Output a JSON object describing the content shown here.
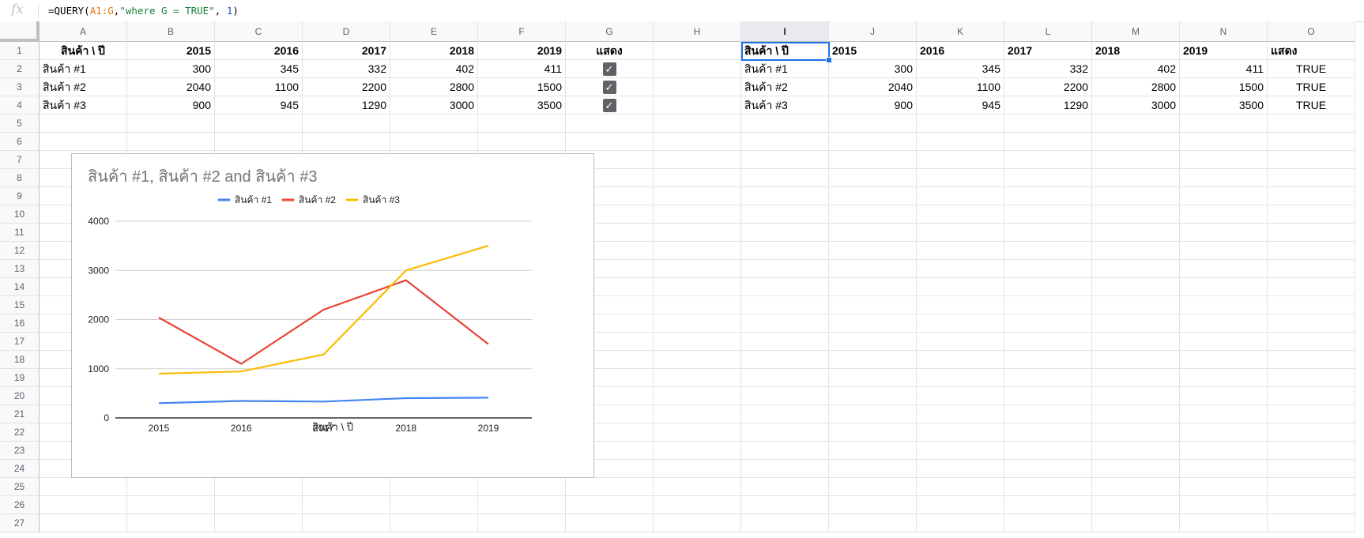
{
  "formula_bar": {
    "fx_label": "fx",
    "prefix": "=QUERY(",
    "range": "A1:G",
    "sep1": ",",
    "query_string": "\"where G = TRUE\"",
    "sep2": ", ",
    "headers_arg": "1",
    "suffix": ")"
  },
  "columns": [
    "A",
    "B",
    "C",
    "D",
    "E",
    "F",
    "G",
    "H",
    "I",
    "J",
    "K",
    "L",
    "M",
    "N",
    "O"
  ],
  "selected_column": "I",
  "rows": [
    "1",
    "2",
    "3",
    "4",
    "5",
    "6",
    "7",
    "8",
    "9",
    "10",
    "11",
    "12",
    "13",
    "14",
    "15",
    "16",
    "17",
    "18",
    "19",
    "20",
    "21",
    "22",
    "23",
    "24",
    "25",
    "26",
    "27"
  ],
  "source_table": {
    "header": [
      "สินค้า \\ ปี",
      "2015",
      "2016",
      "2017",
      "2018",
      "2019",
      "แสดง"
    ],
    "rows": [
      {
        "name": "สินค้า #1",
        "values": [
          "300",
          "345",
          "332",
          "402",
          "411"
        ],
        "checked": true
      },
      {
        "name": "สินค้า #2",
        "values": [
          "2040",
          "1100",
          "2200",
          "2800",
          "1500"
        ],
        "checked": true
      },
      {
        "name": "สินค้า #3",
        "values": [
          "900",
          "945",
          "1290",
          "3000",
          "3500"
        ],
        "checked": true
      }
    ]
  },
  "query_table": {
    "header": [
      "สินค้า \\ ปี",
      "2015",
      "2016",
      "2017",
      "2018",
      "2019",
      "แสดง"
    ],
    "rows": [
      {
        "name": "สินค้า #1",
        "values": [
          "300",
          "345",
          "332",
          "402",
          "411"
        ],
        "flag": "TRUE"
      },
      {
        "name": "สินค้า #2",
        "values": [
          "2040",
          "1100",
          "2200",
          "2800",
          "1500"
        ],
        "flag": "TRUE"
      },
      {
        "name": "สินค้า #3",
        "values": [
          "900",
          "945",
          "1290",
          "3000",
          "3500"
        ],
        "flag": "TRUE"
      }
    ]
  },
  "chart_data": {
    "type": "line",
    "title": "สินค้า #1, สินค้า #2 and สินค้า #3",
    "xlabel": "สินค้า \\ ปี",
    "ylabel": "",
    "categories": [
      "2015",
      "2016",
      "2017",
      "2018",
      "2019"
    ],
    "yticks": [
      "0",
      "1000",
      "2000",
      "3000",
      "4000"
    ],
    "ylim": [
      0,
      4000
    ],
    "grid": true,
    "legend_position": "top",
    "series": [
      {
        "name": "สินค้า #1",
        "color": "#4285f4",
        "values": [
          300,
          345,
          332,
          402,
          411
        ]
      },
      {
        "name": "สินค้า #2",
        "color": "#ea4335",
        "values": [
          2040,
          1100,
          2200,
          2800,
          1500
        ]
      },
      {
        "name": "สินค้า #3",
        "color": "#fbbc04",
        "values": [
          900,
          945,
          1290,
          3000,
          3500
        ]
      }
    ]
  }
}
